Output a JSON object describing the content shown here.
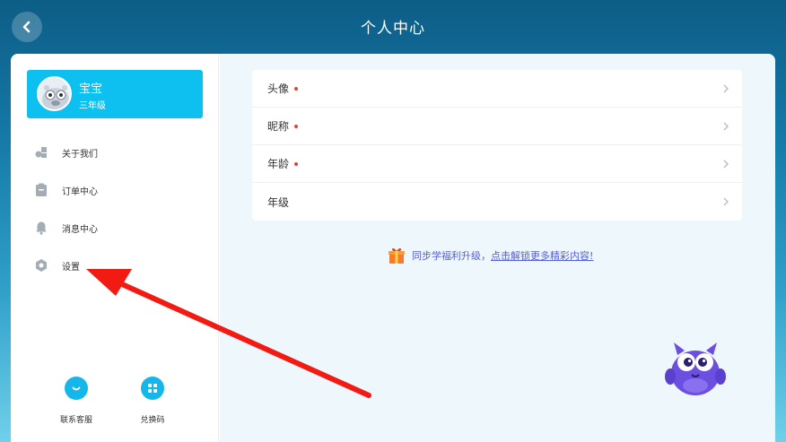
{
  "header": {
    "title": "个人中心",
    "back_icon": "chevron-left-icon"
  },
  "user": {
    "name": "宝宝",
    "grade": "三年级",
    "avatar_icon": "cartoon-avatar-icon"
  },
  "sidebar": {
    "items": [
      {
        "label": "关于我们",
        "icon": "cubes-icon"
      },
      {
        "label": "订单中心",
        "icon": "clipboard-icon"
      },
      {
        "label": "消息中心",
        "icon": "bell-icon"
      },
      {
        "label": "设置",
        "icon": "hexagon-gear-icon"
      }
    ],
    "bottom": [
      {
        "label": "联系客服",
        "icon": "chat-bubble-icon"
      },
      {
        "label": "兑换码",
        "icon": "grid-icon"
      }
    ]
  },
  "profile": {
    "rows": [
      {
        "label": "头像",
        "required_dot": true
      },
      {
        "label": "昵称",
        "required_dot": true
      },
      {
        "label": "年龄",
        "required_dot": true
      },
      {
        "label": "年级",
        "required_dot": false
      }
    ]
  },
  "promo": {
    "text": "同步学福利升级，",
    "link": "点击解锁更多精彩内容!",
    "icon": "gift-icon"
  },
  "colors": {
    "accent": "#0ec0ef",
    "dot": "#e8402e",
    "link": "#5660d6",
    "annotation_arrow": "#f21b14"
  }
}
